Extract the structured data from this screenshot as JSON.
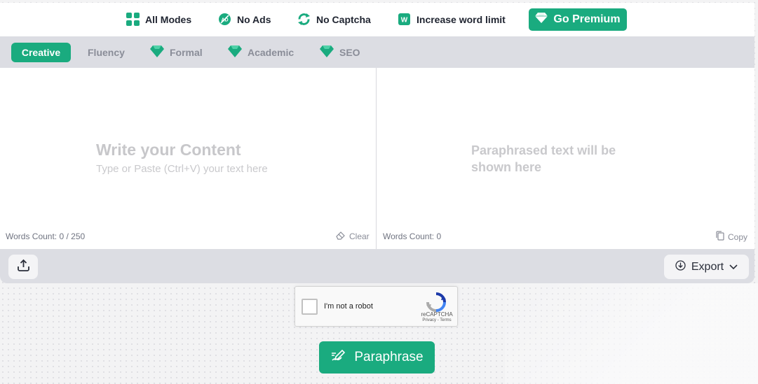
{
  "features": {
    "all_modes": "All Modes",
    "no_ads": "No Ads",
    "no_captcha": "No Captcha",
    "word_limit": "Increase word limit",
    "go_premium": "Go Premium"
  },
  "modes": [
    {
      "label": "Creative",
      "active": true,
      "premium": false
    },
    {
      "label": "Fluency",
      "active": false,
      "premium": false
    },
    {
      "label": "Formal",
      "active": false,
      "premium": true
    },
    {
      "label": "Academic",
      "active": false,
      "premium": true
    },
    {
      "label": "SEO",
      "active": false,
      "premium": true
    }
  ],
  "input": {
    "title": "Write your Content",
    "subtitle": "Type or Paste (Ctrl+V) your text here",
    "word_count": "Words Count: 0 / 250",
    "clear": "Clear"
  },
  "output": {
    "placeholder": "Paraphrased text will be shown here",
    "word_count": "Words Count: 0",
    "copy": "Copy"
  },
  "toolbar": {
    "export": "Export"
  },
  "recaptcha": {
    "label": "I'm not a robot",
    "brand": "reCAPTCHA",
    "terms": "Privacy - Terms"
  },
  "paraphrase_button": "Paraphrase",
  "colors": {
    "accent": "#1aab7f",
    "toolbar_bg": "#dcdde3"
  }
}
